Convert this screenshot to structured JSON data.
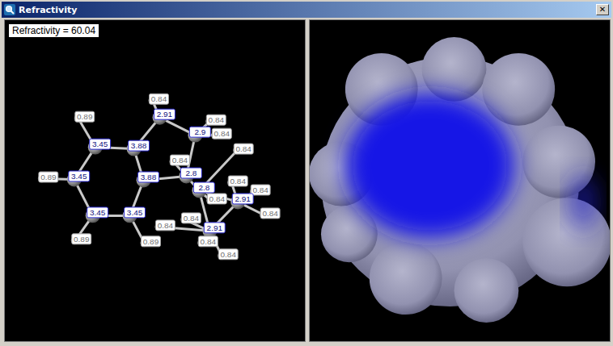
{
  "window": {
    "title": "Refractivity",
    "close": "✕"
  },
  "molecule": {
    "readout": "Refractivity = 60.04",
    "atoms": [
      {
        "kind": "carbon",
        "label": "3.45"
      },
      {
        "kind": "carbon",
        "label": "3.88"
      },
      {
        "kind": "carbon",
        "label": "2.91"
      },
      {
        "kind": "carbon",
        "label": "2.9"
      },
      {
        "kind": "carbon",
        "label": "3.45"
      },
      {
        "kind": "carbon",
        "label": "3.88"
      },
      {
        "kind": "carbon",
        "label": "2.8"
      },
      {
        "kind": "carbon",
        "label": "2.8"
      },
      {
        "kind": "carbon",
        "label": "3.45"
      },
      {
        "kind": "carbon",
        "label": "3.45"
      },
      {
        "kind": "carbon",
        "label": "2.91"
      },
      {
        "kind": "carbon",
        "label": "2.91"
      },
      {
        "kind": "hydrogen",
        "label": "0.89"
      },
      {
        "kind": "hydrogen",
        "label": "0.89"
      },
      {
        "kind": "hydrogen",
        "label": "0.89"
      },
      {
        "kind": "hydrogen",
        "label": "0.89"
      },
      {
        "kind": "hydrogen",
        "label": "0.84"
      },
      {
        "kind": "hydrogen",
        "label": "0.84"
      },
      {
        "kind": "hydrogen",
        "label": "0.84"
      },
      {
        "kind": "hydrogen",
        "label": "0.84"
      },
      {
        "kind": "hydrogen",
        "label": "0.84"
      },
      {
        "kind": "hydrogen",
        "label": "0.84"
      },
      {
        "kind": "hydrogen",
        "label": "0.84"
      },
      {
        "kind": "hydrogen",
        "label": "0.84"
      },
      {
        "kind": "hydrogen",
        "label": "0.84"
      },
      {
        "kind": "hydrogen",
        "label": "0.84"
      },
      {
        "kind": "hydrogen",
        "label": "0.84"
      },
      {
        "kind": "hydrogen",
        "label": "0.84"
      },
      {
        "kind": "hydrogen",
        "label": "0.84"
      }
    ]
  }
}
